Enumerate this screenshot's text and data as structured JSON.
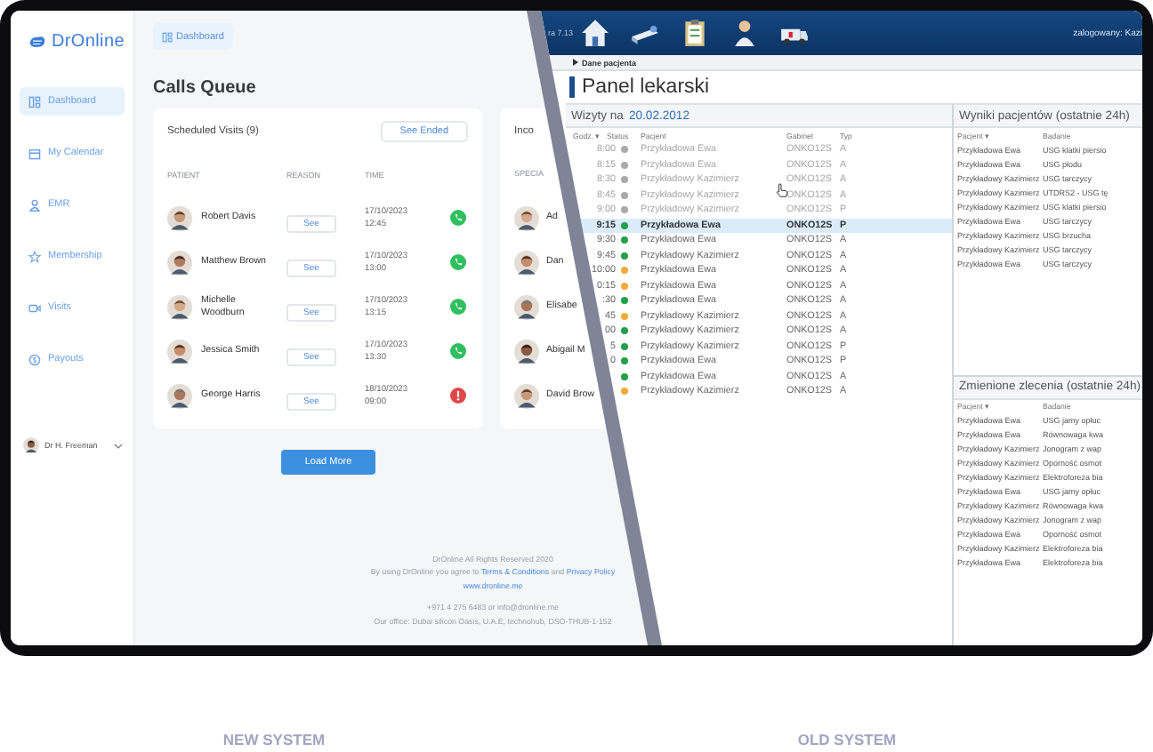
{
  "brand": {
    "name": "DrOnline"
  },
  "sidebar": {
    "items": [
      {
        "label": "Dashboard",
        "selected": true
      },
      {
        "label": "My Calendar",
        "selected": false
      },
      {
        "label": "EMR",
        "selected": false
      },
      {
        "label": "Membership",
        "selected": false
      },
      {
        "label": "Visits",
        "selected": false
      },
      {
        "label": "Payouts",
        "selected": false
      }
    ],
    "user": {
      "name": "Dr H. Freeman"
    }
  },
  "breadcrumb": "Dashboard",
  "page_title": "Calls Queue",
  "scheduled": {
    "title": "Scheduled Visits (9)",
    "action": "See Ended",
    "columns": [
      "PATIENT",
      "REASON",
      "TIME"
    ],
    "rows": [
      {
        "patient": "Robert Davis",
        "reason": "See",
        "date": "17/10/2023",
        "time": "12:45",
        "kind": "call"
      },
      {
        "patient": "Matthew Brown",
        "reason": "See",
        "date": "17/10/2023",
        "time": "13:00",
        "kind": "call"
      },
      {
        "patient": "Michelle Woodburn",
        "reason": "See",
        "date": "17/10/2023",
        "time": "13:15",
        "kind": "call"
      },
      {
        "patient": "Jessica Smith",
        "reason": "See",
        "date": "17/10/2023",
        "time": "13:30",
        "kind": "call"
      },
      {
        "patient": "George Harris",
        "reason": "See",
        "date": "18/10/2023",
        "time": "09:00",
        "kind": "alert"
      }
    ]
  },
  "incoming": {
    "title": "Inco",
    "column": "SPECIA",
    "rows": [
      {
        "name": "Ad"
      },
      {
        "name": "Dan"
      },
      {
        "name": "Elisabe"
      },
      {
        "name": "Abigail M"
      },
      {
        "name": "David Brow"
      }
    ]
  },
  "load_more": "Load More",
  "footer": {
    "copyright": "DrOnline All Rights Reserved 2020",
    "terms": [
      {
        "text": "By using DrOnline you agree to ",
        "link": false
      },
      {
        "text": "Terms & Conditions",
        "link": true
      },
      {
        "text": " and ",
        "link": false
      },
      {
        "text": "Privacy Policy",
        "link": true
      }
    ],
    "website": "www.dronline.me",
    "contact": "+971 4 275 6483 or info@dronline.me",
    "office": "Our office: Dubai silicon Oasis, U.A.E, technohub, DSO-THUB-1-152"
  },
  "old_system": {
    "version": "ra 7.13",
    "user": "zalogowany: Kazi",
    "breadcrumb": "Dane pacjenta",
    "title": "Panel lekarski",
    "visits": {
      "title": "Wizyty na",
      "date": "20.02.2012",
      "columns": [
        "Godz. ▾",
        "Status",
        "Pacjent",
        "Gabinet",
        "Typ"
      ],
      "rows": [
        {
          "time": "8:00",
          "color": "#a9a9a9",
          "patient": "Przykładowa Ewa",
          "room": "ONKO12S",
          "type": "A",
          "past": true,
          "selected": false
        },
        {
          "time": "8:15",
          "color": "#a9a9a9",
          "patient": "Przykładowa Ewa",
          "room": "ONKO12S",
          "type": "A",
          "past": true,
          "selected": false
        },
        {
          "time": "8:30",
          "color": "#a9a9a9",
          "patient": "Przykładowy Kazimierz",
          "room": "ONKO12S",
          "type": "A",
          "past": true,
          "selected": false
        },
        {
          "time": "8:45",
          "color": "#a9a9a9",
          "patient": "Przykładowy Kazimierz",
          "room": "ONKO12S",
          "type": "A",
          "past": true,
          "selected": false
        },
        {
          "time": "9:00",
          "color": "#a9a9a9",
          "patient": "Przykładowy Kazimierz",
          "room": "ONKO12S",
          "type": "P",
          "past": true,
          "selected": false
        },
        {
          "time": "9:15",
          "color": "#22a04a",
          "patient": "Przykładowa Ewa",
          "room": "ONKO12S",
          "type": "P",
          "past": false,
          "selected": true
        },
        {
          "time": "9:30",
          "color": "#22a04a",
          "patient": "Przykładowa Ewa",
          "room": "ONKO12S",
          "type": "A",
          "past": false,
          "selected": false
        },
        {
          "time": "9:45",
          "color": "#22a04a",
          "patient": "Przykładowy Kazimierz",
          "room": "ONKO12S",
          "type": "A",
          "past": false,
          "selected": false
        },
        {
          "time": "10:00",
          "color": "#f2a93b",
          "patient": "Przykładowa Ewa",
          "room": "ONKO12S",
          "type": "A",
          "past": false,
          "selected": false
        },
        {
          "time": "0:15",
          "color": "#f2a93b",
          "patient": "Przykładowa Ewa",
          "room": "ONKO12S",
          "type": "A",
          "past": false,
          "selected": false
        },
        {
          "time": ":30",
          "color": "#22a04a",
          "patient": "Przykładowa Ewa",
          "room": "ONKO12S",
          "type": "A",
          "past": false,
          "selected": false
        },
        {
          "time": "45",
          "color": "#f2a93b",
          "patient": "Przykładowy Kazimierz",
          "room": "ONKO12S",
          "type": "A",
          "past": false,
          "selected": false
        },
        {
          "time": "00",
          "color": "#22a04a",
          "patient": "Przykładowy Kazimierz",
          "room": "ONKO12S",
          "type": "A",
          "past": false,
          "selected": false
        },
        {
          "time": "5",
          "color": "#22a04a",
          "patient": "Przykładowy Kazimierz",
          "room": "ONKO12S",
          "type": "P",
          "past": false,
          "selected": false
        },
        {
          "time": "0",
          "color": "#22a04a",
          "patient": "Przykładowa Ewa",
          "room": "ONKO12S",
          "type": "P",
          "past": false,
          "selected": false
        },
        {
          "color": "#22a04a",
          "patient": "Przykładowa Ewa",
          "room": "ONKO12S",
          "type": "A",
          "past": false,
          "selected": false
        },
        {
          "color": "#f2a93b",
          "patient": "Przykładowy Kazimierz",
          "room": "ONKO12S",
          "type": "A",
          "past": false,
          "selected": false
        }
      ]
    },
    "results": {
      "title": "Wyniki pacjentów (ostatnie 24h)",
      "columns": [
        "Pacjent ▾",
        "Badanie"
      ],
      "rows": [
        {
          "patient": "Przykładowa Ewa",
          "test": "USG klatki piersio"
        },
        {
          "patient": "Przykładowa Ewa",
          "test": "USG płodu"
        },
        {
          "patient": "Przykładowy Kazimierz",
          "test": "USG tarczycy"
        },
        {
          "patient": "Przykładowy Kazimierz",
          "test": "UTDRS2 - USG tę"
        },
        {
          "patient": "Przykładowy Kazimierz",
          "test": "USG klatki piersio"
        },
        {
          "patient": "Przykładowa Ewa",
          "test": "USG tarczycy"
        },
        {
          "patient": "Przykładowy Kazimierz",
          "test": "USG brzucha"
        },
        {
          "patient": "Przykładowy Kazimierz",
          "test": "USG tarczycy"
        },
        {
          "patient": "Przykładowa Ewa",
          "test": "USG tarczycy"
        }
      ]
    },
    "orders": {
      "title": "Zmienione zlecenia (ostatnie 24h)",
      "columns": [
        "Pacjent ▾",
        "Badanie"
      ],
      "rows": [
        {
          "patient": "Przykładowa Ewa",
          "test": "USG jamy opłuc"
        },
        {
          "patient": "Przykładowa Ewa",
          "test": "Równowaga kwa"
        },
        {
          "patient": "Przykładowy Kazimierz",
          "test": "Jonogram z wap"
        },
        {
          "patient": "Przykładowy Kazimierz",
          "test": "Oporność osmot"
        },
        {
          "patient": "Przykładowy Kazimierz",
          "test": "Elektroforeza bia"
        },
        {
          "patient": "Przykładowa Ewa",
          "test": "USG jamy opłuc"
        },
        {
          "patient": "Przykładowy Kazimierz",
          "test": "Równowaga kwa"
        },
        {
          "patient": "Przykładowy Kazimierz",
          "test": "Jonogram z wap"
        },
        {
          "patient": "Przykładowa Ewa",
          "test": "Oporność osmot"
        },
        {
          "patient": "Przykładowy Kazimierz",
          "test": "Elektroforeza bia"
        },
        {
          "patient": "Przykładowa Ewa",
          "test": "Elektroforeza bia"
        }
      ]
    }
  },
  "labels": [
    "NEW SYSTEM",
    "OLD SYSTEM"
  ]
}
